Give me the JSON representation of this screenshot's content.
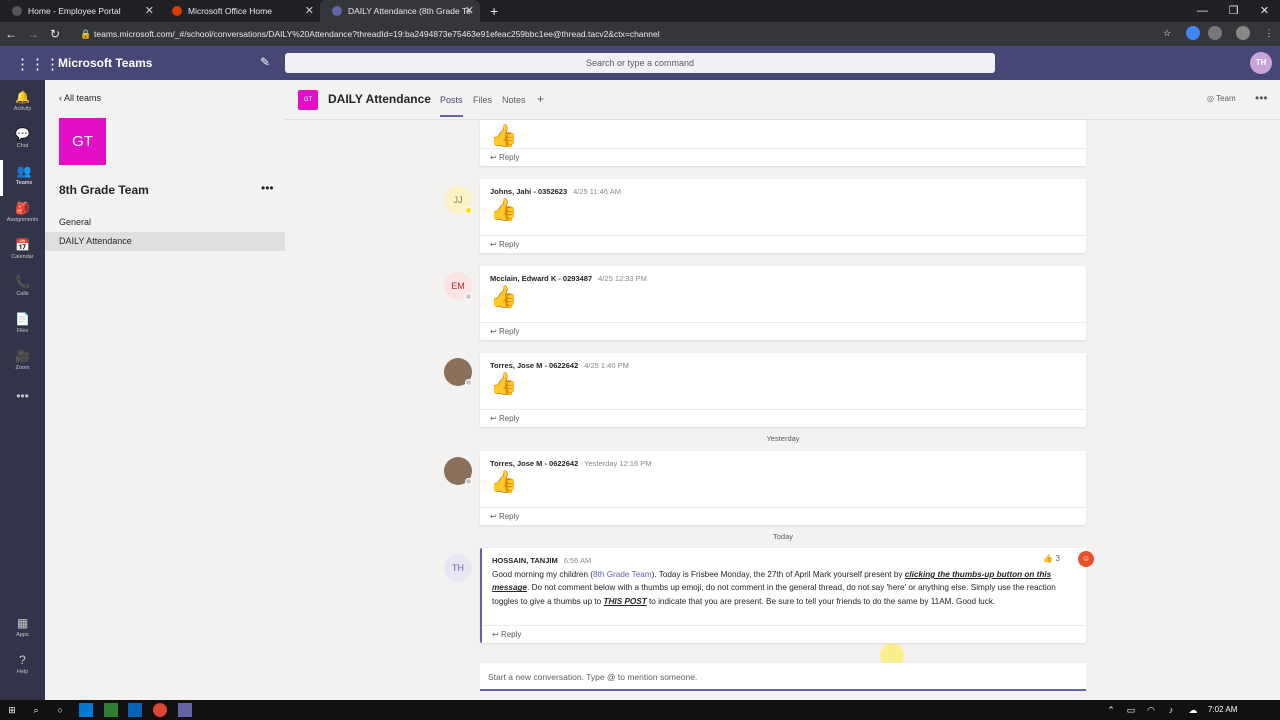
{
  "browser": {
    "tabs": [
      {
        "title": "Home - Employee Portal",
        "color": "#3c3c3c"
      },
      {
        "title": "Microsoft Office Home",
        "color": "#d83b01"
      },
      {
        "title": "DAILY Attendance (8th Grade Te",
        "color": "#6264a7"
      }
    ],
    "url": "teams.microsoft.com/_#/school/conversations/DAILY%20Attendance?threadId=19:ba2494873e75463e91efeac259bbc1ee@thread.tacv2&ctx=channel"
  },
  "header": {
    "app_name": "Microsoft Teams",
    "search_placeholder": "Search or type a command",
    "user_initials": "TH"
  },
  "rail": {
    "items": [
      {
        "label": "Activity",
        "icon": "bell-icon",
        "glyph": "🔔"
      },
      {
        "label": "Chat",
        "icon": "chat-icon",
        "glyph": "💬"
      },
      {
        "label": "Teams",
        "icon": "teams-icon",
        "glyph": "👥"
      },
      {
        "label": "Assignments",
        "icon": "assignments-icon",
        "glyph": "🎒"
      },
      {
        "label": "Calendar",
        "icon": "calendar-icon",
        "glyph": "📅"
      },
      {
        "label": "Calls",
        "icon": "phone-icon",
        "glyph": "📞"
      },
      {
        "label": "Files",
        "icon": "file-icon",
        "glyph": "📄"
      },
      {
        "label": "Zoom",
        "icon": "zoom-icon",
        "glyph": "🎥"
      },
      {
        "label": "",
        "icon": "more-icon",
        "glyph": "•••"
      }
    ],
    "bottom": [
      {
        "label": "Apps",
        "icon": "apps-icon",
        "glyph": "▦"
      },
      {
        "label": "Help",
        "icon": "help-icon",
        "glyph": "?"
      }
    ]
  },
  "team_panel": {
    "back_label": "All teams",
    "team_initials": "GT",
    "team_name": "8th Grade Team",
    "channels": [
      "General",
      "DAILY Attendance"
    ]
  },
  "channel": {
    "icon_text": "GT",
    "title": "DAILY Attendance",
    "tabs": [
      "Posts",
      "Files",
      "Notes"
    ],
    "team_button": "Team"
  },
  "posts": [
    {
      "author": "",
      "time": "",
      "initials": "",
      "reply": "Reply"
    },
    {
      "author": "Johns, Jahi - 0352623",
      "time": "4/25 11:46 AM",
      "initials": "JJ",
      "reply": "Reply"
    },
    {
      "author": "Mcclain, Edward K - 0293487",
      "time": "4/25 12:33 PM",
      "initials": "EM",
      "reply": "Reply"
    },
    {
      "author": "Torres, Jose M - 0622642",
      "time": "4/25 1:40 PM",
      "initials": "",
      "reply": "Reply"
    },
    {
      "author": "Torres, Jose M - 0622642",
      "time": "Yesterday 12:16 PM",
      "initials": "",
      "reply": "Reply"
    }
  ],
  "separators": {
    "yesterday": "Yesterday",
    "today": "Today"
  },
  "announcement": {
    "author": "HOSSAIN, TANJIM",
    "time": "6:56 AM",
    "initials": "TH",
    "reaction": "👍 3",
    "text_1": "Good morning my children (",
    "link": "8th Grade Team",
    "text_2": "). Today is Frisbee Monday, the 27th of April Mark yourself present by ",
    "bold_1": "clicking the thumbs-up button on this message",
    "text_3": ". Do not comment below with a thumbs up emoji, do not comment in the general thread, do not say 'here' or anything else. Simply use the reaction toggles to give a thumbs up to ",
    "bold_2": "THIS POST",
    "text_4": " to indicate that you are present. Be sure to tell your friends to do the same by 11AM. Good luck.",
    "reply": "Reply"
  },
  "compose": {
    "placeholder": "Start a new conversation. Type @ to mention someone."
  },
  "taskbar": {
    "time": "7:02 AM"
  }
}
